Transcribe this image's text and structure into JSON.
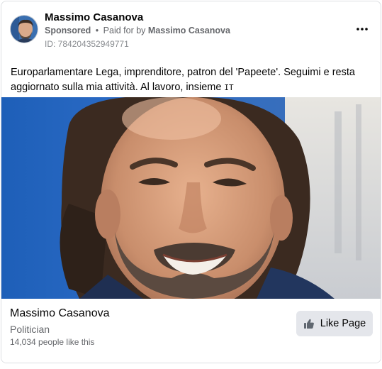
{
  "post": {
    "page_name": "Massimo Casanova",
    "sponsored_label": "Sponsored",
    "separator": "•",
    "paid_for_prefix": "Paid for by",
    "paid_for_name": "Massimo Casanova",
    "ad_id": "ID: 784204352949771",
    "more_icon": "more-horizontal-icon",
    "text": "Europarlamentare Lega, imprenditore, patron del 'Papeete'. Seguimi e resta aggiornato sulla mia attività. Al lavoro, insieme",
    "language_badge": "IT"
  },
  "footer": {
    "name": "Massimo Casanova",
    "category": "Politician",
    "likes": "14,034 people like this",
    "like_button_label": "Like Page",
    "like_icon": "thumbs-up-icon"
  },
  "colors": {
    "text_primary": "#050505",
    "text_secondary": "#65676b",
    "button_bg": "#e4e6eb",
    "border": "#dddfe2"
  }
}
